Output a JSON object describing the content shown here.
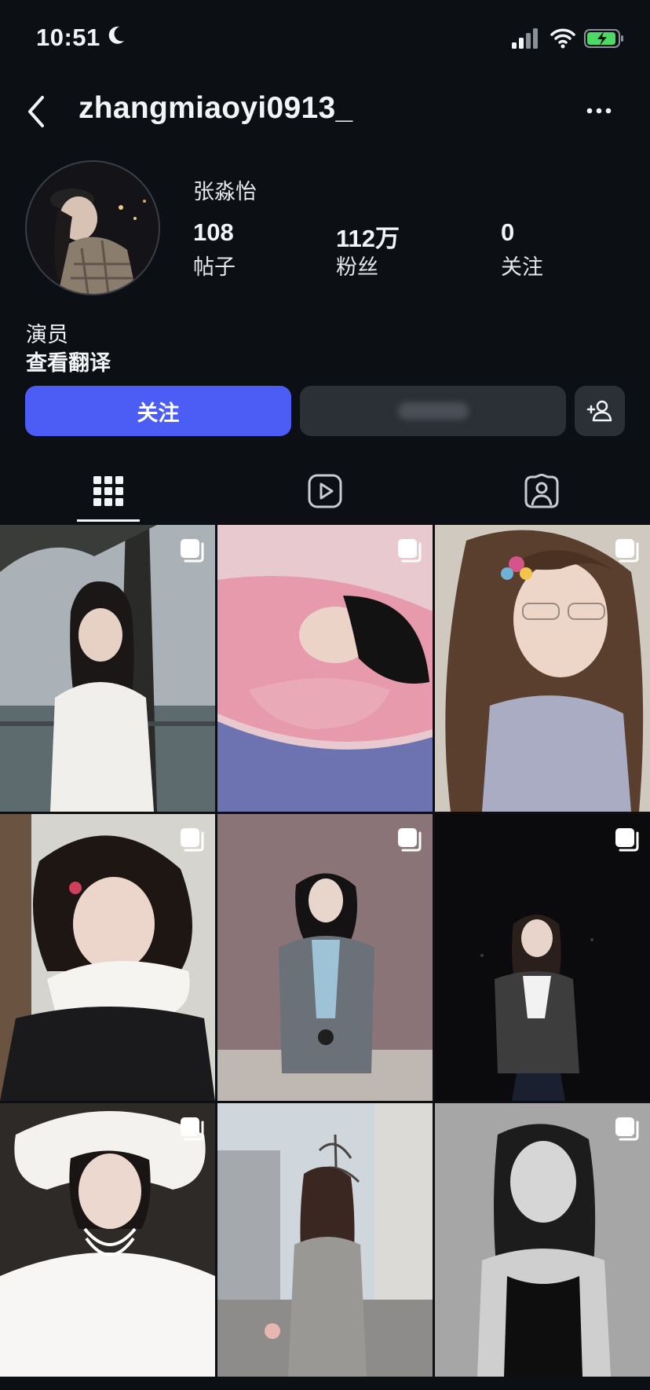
{
  "status_bar": {
    "time": "10:51",
    "icons": [
      "moon-icon",
      "signal-icon",
      "wifi-icon",
      "battery-charging-icon"
    ]
  },
  "header": {
    "username": "zhangmiaoyi0913_"
  },
  "profile": {
    "display_name": "张淼怡",
    "stats": [
      {
        "value": "108",
        "label": "帖子"
      },
      {
        "value": "112万",
        "label": "粉丝"
      },
      {
        "value": "0",
        "label": "关注"
      }
    ],
    "bio_line": "演员",
    "translate_link": "查看翻译"
  },
  "actions": {
    "follow_label": "关注"
  },
  "tabs": [
    {
      "icon": "grid-icon",
      "active": true
    },
    {
      "icon": "reels-play-icon",
      "active": false
    },
    {
      "icon": "tagged-person-icon",
      "active": false
    }
  ],
  "colors": {
    "background": "#0c0f14",
    "follow_button": "#4c5df5",
    "secondary_button": "#2b2f36"
  },
  "posts": [
    {
      "type": "carousel"
    },
    {
      "type": "carousel"
    },
    {
      "type": "carousel"
    },
    {
      "type": "carousel"
    },
    {
      "type": "carousel"
    },
    {
      "type": "carousel"
    },
    {
      "type": "carousel"
    },
    {
      "type": "carousel"
    },
    {
      "type": "carousel"
    }
  ]
}
